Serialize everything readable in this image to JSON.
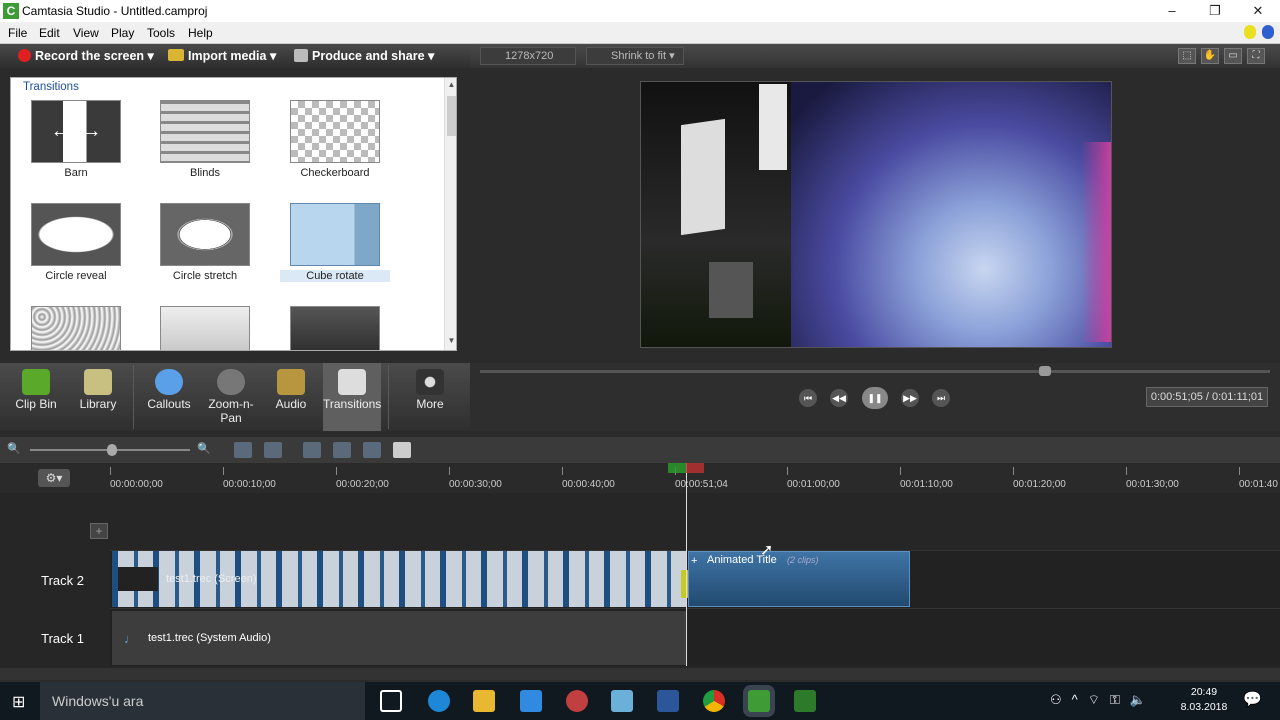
{
  "window": {
    "title": "Camtasia Studio - Untitled.camproj",
    "min": "–",
    "max": "❐",
    "close": "✕"
  },
  "menu": [
    "File",
    "Edit",
    "View",
    "Play",
    "Tools",
    "Help"
  ],
  "toolbar": {
    "record": "Record the screen ▾",
    "import": "Import media ▾",
    "produce": "Produce and share ▾"
  },
  "transitions": {
    "header": "Transitions",
    "items": [
      "Barn",
      "Blinds",
      "Checkerboard",
      "Circle reveal",
      "Circle stretch",
      "Cube rotate"
    ]
  },
  "tabs": [
    "Clip Bin",
    "Library",
    "Callouts",
    "Zoom-n-\nPan",
    "Audio",
    "Transitions",
    "More"
  ],
  "preview": {
    "size": "1278x720",
    "zoom": "Shrink to fit ▾",
    "time": "0:00:51;05 / 0:01:11;01"
  },
  "ruler": {
    "labels": [
      "00:00:00;00",
      "00:00:10;00",
      "00:00:20;00",
      "00:00:30;00",
      "00:00:40;00",
      "00:00:51;04",
      "00:01:00;00",
      "00:01:10;00",
      "00:01:20;00",
      "00:01:30;00",
      "00:01:40"
    ]
  },
  "tracks": {
    "track2": "Track 2",
    "track1": "Track 1",
    "clip_screen": "test1.trec (Screen)",
    "clip_title": "Animated Title",
    "clip_title_count": "(2 clips)",
    "clip_audio": "test1.trec (System Audio)"
  },
  "taskbar": {
    "search": "Windows'u ara",
    "time": "20:49",
    "date": "8.03.2018"
  },
  "colors": {
    "accent": "#3e9b35",
    "selection_blue": "#3f74a6"
  }
}
